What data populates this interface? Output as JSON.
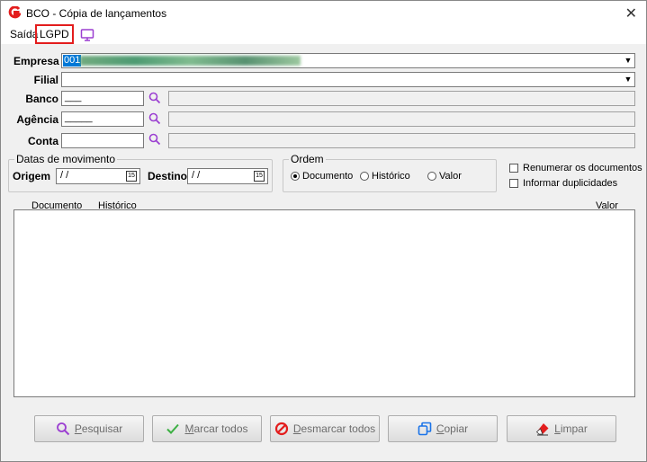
{
  "window": {
    "title": "BCO - Cópia de lançamentos",
    "close_glyph": "✕"
  },
  "menu": {
    "saida": "Saída",
    "lgpd": "LGPD"
  },
  "form": {
    "empresa_label": "Empresa",
    "empresa_value": "001",
    "filial_label": "Filial",
    "banco_label": "Banco",
    "banco_value": "___",
    "agencia_label": "Agência",
    "agencia_value": "_____",
    "conta_label": "Conta",
    "combo_arrow": "▼"
  },
  "datas": {
    "group_title": "Datas de movimento",
    "origem_label": "Origem",
    "origem_value": "/ /",
    "destino_label": "Destino",
    "destino_value": "/ /",
    "calendar_text": "15"
  },
  "ordem": {
    "group_title": "Ordem",
    "options": [
      "Documento",
      "Histórico",
      "Valor"
    ],
    "selected": "Documento"
  },
  "options": {
    "renumerar": "Renumerar os documentos",
    "duplicidades": "Informar duplicidades"
  },
  "list": {
    "columns": [
      "Documento",
      "Histórico",
      "Valor"
    ]
  },
  "buttons": {
    "pesquisar": {
      "hotkey": "P",
      "rest": "esquisar"
    },
    "marcar": {
      "hotkey": "M",
      "rest": "arcar todos"
    },
    "desmarcar": {
      "hotkey": "D",
      "rest": "esmarcar todos"
    },
    "copiar": {
      "hotkey": "C",
      "rest": "opiar"
    },
    "limpar": {
      "hotkey": "L",
      "rest": "impar"
    }
  },
  "colors": {
    "accent": "#0078d7",
    "lgpd_border": "#e31d1d",
    "search": "#9b3fd1",
    "brand": "#e31d1d"
  }
}
